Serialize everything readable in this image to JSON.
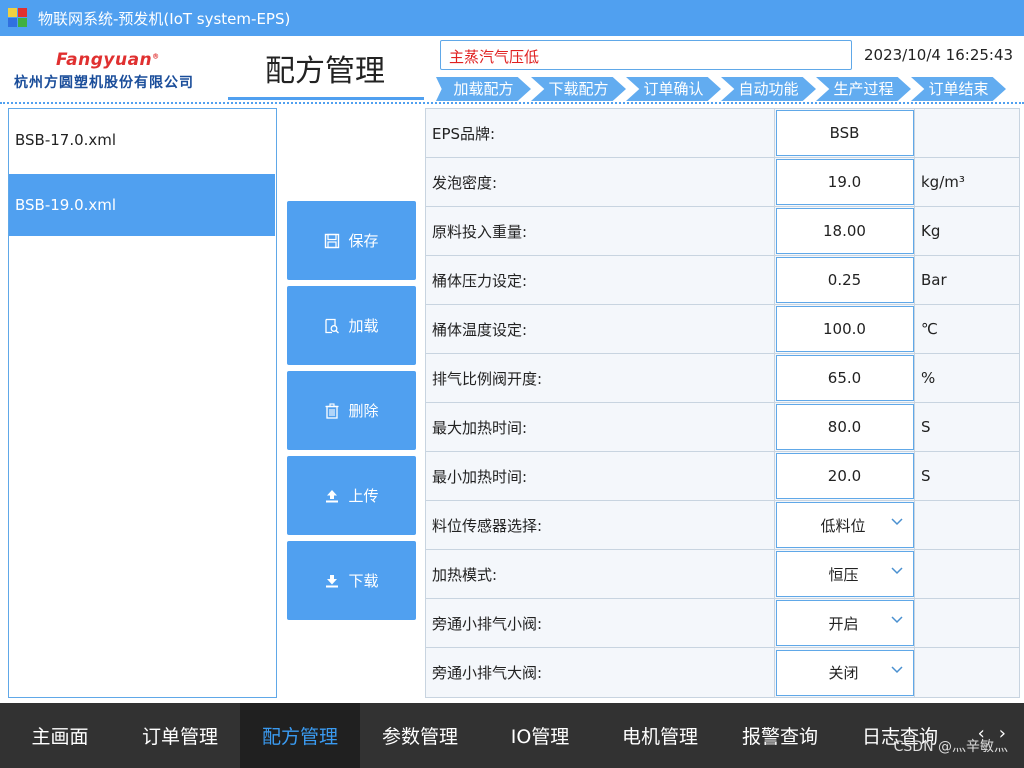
{
  "window": {
    "title": "物联网系统-预发机(IoT system-EPS)"
  },
  "header": {
    "brand": "Fangyuan",
    "brand_mark": "®",
    "company": "杭州方圆塑机股份有限公司",
    "page_title": "配方管理",
    "alarm_text": "主蒸汽气压低",
    "datetime": "2023/10/4 16:25:43",
    "steps": [
      "加载配方",
      "下载配方",
      "订单确认",
      "自动功能",
      "生产过程",
      "订单结束"
    ]
  },
  "files": {
    "items": [
      "BSB-17.0.xml",
      "BSB-19.0.xml"
    ],
    "selected_index": 1
  },
  "actions": {
    "save": "保存",
    "load": "加载",
    "delete": "删除",
    "upload": "上传",
    "download": "下载"
  },
  "params": [
    {
      "label": "EPS品牌:",
      "value": "BSB",
      "unit": ""
    },
    {
      "label": "发泡密度:",
      "value": "19.0",
      "unit": "kg/m³"
    },
    {
      "label": "原料投入重量:",
      "value": "18.00",
      "unit": "Kg"
    },
    {
      "label": "桶体压力设定:",
      "value": "0.25",
      "unit": "Bar"
    },
    {
      "label": "桶体温度设定:",
      "value": "100.0",
      "unit": "℃"
    },
    {
      "label": "排气比例阀开度:",
      "value": "65.0",
      "unit": "%"
    },
    {
      "label": "最大加热时间:",
      "value": "80.0",
      "unit": "S"
    },
    {
      "label": "最小加热时间:",
      "value": "20.0",
      "unit": "S"
    },
    {
      "label": "料位传感器选择:",
      "value": "低料位",
      "unit": ""
    },
    {
      "label": "加热模式:",
      "value": "恒压",
      "unit": ""
    },
    {
      "label": "旁通小排气小阀:",
      "value": "开启",
      "unit": ""
    },
    {
      "label": "旁通小排气大阀:",
      "value": "关闭",
      "unit": ""
    }
  ],
  "nav": {
    "items": [
      "主画面",
      "订单管理",
      "配方管理",
      "参数管理",
      "IO管理",
      "电机管理",
      "报警查询",
      "日志查询"
    ],
    "active_index": 2,
    "prev": "‹",
    "next": "›"
  },
  "watermark": "CSDN @灬辛敏灬",
  "colors": {
    "accent": "#50a0f0",
    "alarm": "#e02020",
    "nav_bg": "#323232",
    "nav_active_text": "#3a9af0"
  }
}
